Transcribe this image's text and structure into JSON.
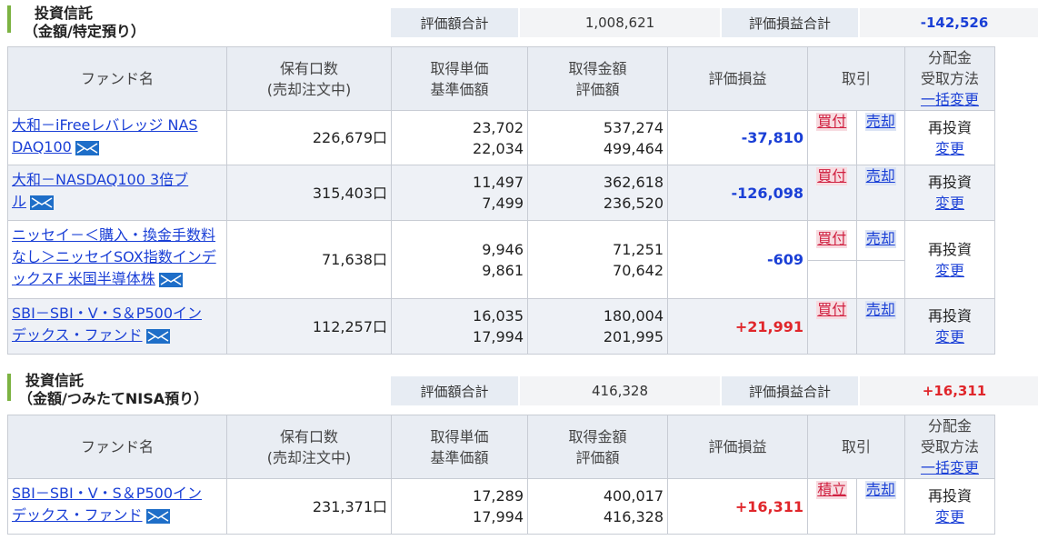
{
  "sections": [
    {
      "title_line1": "投資信託",
      "title_line2": "（金額/特定預り）",
      "summary": {
        "eval_total_label": "評価額合計",
        "eval_total_value": "1,008,621",
        "pl_total_label": "評価損益合計",
        "pl_total_value": "-142,526"
      },
      "headers": {
        "fund_name": "ファンド名",
        "holdings_1": "保有口数",
        "holdings_2": "(売却注文中)",
        "unit_price_1": "取得単価",
        "unit_price_2": "基準価額",
        "amount_1": "取得金額",
        "amount_2": "評価額",
        "pl": "評価損益",
        "trade": "取引",
        "dist_1": "分配金",
        "dist_2": "受取方法",
        "dist_link": "一括変更"
      },
      "rows": [
        {
          "name_l1": "大和－iFreeレバレッジ NAS",
          "name_l2": "DAQ100",
          "units": "226,679口",
          "acq_price": "23,702",
          "base_price": "22,034",
          "acq_amount": "537,274",
          "eval_amount": "499,464",
          "pl": "-37,810",
          "buy": "買付",
          "sell": "売却",
          "dist": "再投資",
          "change": "変更"
        },
        {
          "name_l1": "大和－NASDAQ100 3倍ブ",
          "name_l2": "ル",
          "units": "315,403口",
          "acq_price": "11,497",
          "base_price": "7,499",
          "acq_amount": "362,618",
          "eval_amount": "236,520",
          "pl": "-126,098",
          "buy": "買付",
          "sell": "売却",
          "dist": "再投資",
          "change": "変更"
        },
        {
          "name_l1": "ニッセイ－＜購入・換金手数料",
          "name_l2": "なし＞ニッセイSOX指数インデ",
          "name_l3": "ックスF 米国半導体株",
          "units": "71,638口",
          "acq_price": "9,946",
          "base_price": "9,861",
          "acq_amount": "71,251",
          "eval_amount": "70,642",
          "pl": "-609",
          "buy": "買付",
          "sell": "売却",
          "dist": "再投資",
          "change": "変更"
        },
        {
          "name_l1": "SBI－SBI・V・S＆P500イン",
          "name_l2": "デックス・ファンド",
          "units": "112,257口",
          "acq_price": "16,035",
          "base_price": "17,994",
          "acq_amount": "180,004",
          "eval_amount": "201,995",
          "pl": "+21,991",
          "buy": "買付",
          "sell": "売却",
          "dist": "再投資",
          "change": "変更"
        }
      ]
    },
    {
      "title_line1": "投資信託",
      "title_line2": "（金額/つみたてNISA預り）",
      "summary": {
        "eval_total_label": "評価額合計",
        "eval_total_value": "416,328",
        "pl_total_label": "評価損益合計",
        "pl_total_value": "+16,311"
      },
      "headers": {
        "fund_name": "ファンド名",
        "holdings_1": "保有口数",
        "holdings_2": "(売却注文中)",
        "unit_price_1": "取得単価",
        "unit_price_2": "基準価額",
        "amount_1": "取得金額",
        "amount_2": "評価額",
        "pl": "評価損益",
        "trade": "取引",
        "dist_1": "分配金",
        "dist_2": "受取方法",
        "dist_link": "一括変更"
      },
      "rows": [
        {
          "name_l1": "SBI－SBI・V・S＆P500イン",
          "name_l2": "デックス・ファンド",
          "units": "231,371口",
          "acq_price": "17,289",
          "base_price": "17,994",
          "acq_amount": "400,017",
          "eval_amount": "416,328",
          "pl": "+16,311",
          "buy": "積立",
          "sell": "売却",
          "dist": "再投資",
          "change": "変更"
        }
      ]
    }
  ],
  "colors": {
    "negative": "#1a3fd6",
    "positive": "#e0262b",
    "accent_bar": "#7cb342"
  },
  "icons": {
    "mail": "mail-icon"
  }
}
